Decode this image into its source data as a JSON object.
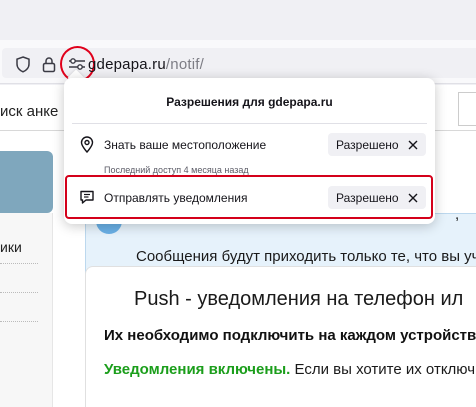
{
  "browser": {
    "url_host": "gdepapa.ru",
    "url_path": "/notif/",
    "icons": [
      "shield-icon",
      "lock-icon",
      "permissions-icon"
    ]
  },
  "page": {
    "header_text": "иск анке",
    "left_label": "ики",
    "info_line1": ",",
    "info_line2": "Сообщения будут приходить только те, что вы уч",
    "push_title": "Push - уведомления на телефон ил",
    "push_bold": "Их необходимо подключить на каждом устройств",
    "push_status_green": "Уведомления включены.",
    "push_status_rest": " Если вы хотите их отключ"
  },
  "popup": {
    "title": "Разрешения для gdepapa.ru",
    "rows": [
      {
        "label": "Знать ваше местоположение",
        "badge": "Разрешено",
        "sub": "Последний доступ 4 месяца назад",
        "icon": "location-icon"
      },
      {
        "label": "Отправлять уведомления",
        "badge": "Разрешено",
        "icon": "notification-icon"
      }
    ]
  },
  "colors": {
    "highlight_red": "#d4001a",
    "green_status": "#1b9e1b",
    "info_bg": "#e6f2fb",
    "left_panel": "#7fa7bd"
  }
}
